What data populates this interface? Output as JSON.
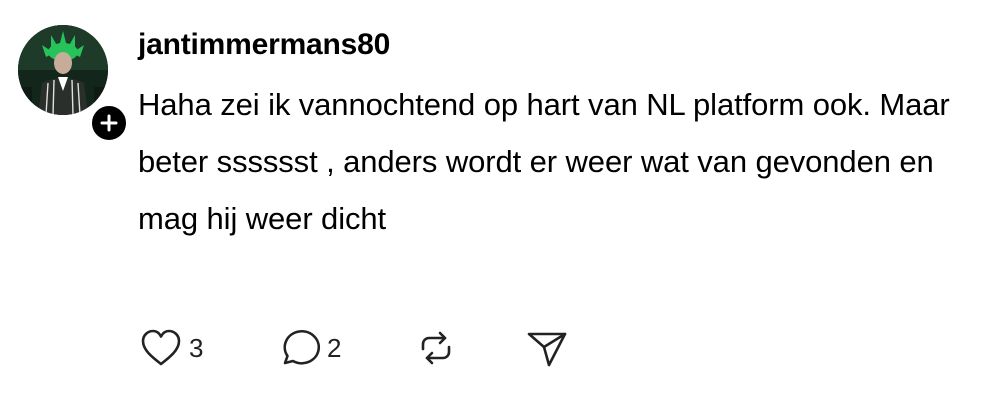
{
  "post": {
    "username": "jantimmermans80",
    "text": "Haha zei ik vannochtend op hart van NL platform ook. Maar beter sssssst , anders wordt er weer wat van gevonden en mag hij weer dicht",
    "avatar_icon": "profile-photo",
    "follow_icon": "plus-icon"
  },
  "actions": {
    "like_count": "3",
    "reply_count": "2",
    "like_icon": "heart-icon",
    "reply_icon": "speech-bubble-icon",
    "repost_icon": "repost-icon",
    "share_icon": "send-icon"
  },
  "colors": {
    "text": "#000000",
    "icon": "#222222",
    "background": "#ffffff",
    "badge": "#000000"
  }
}
